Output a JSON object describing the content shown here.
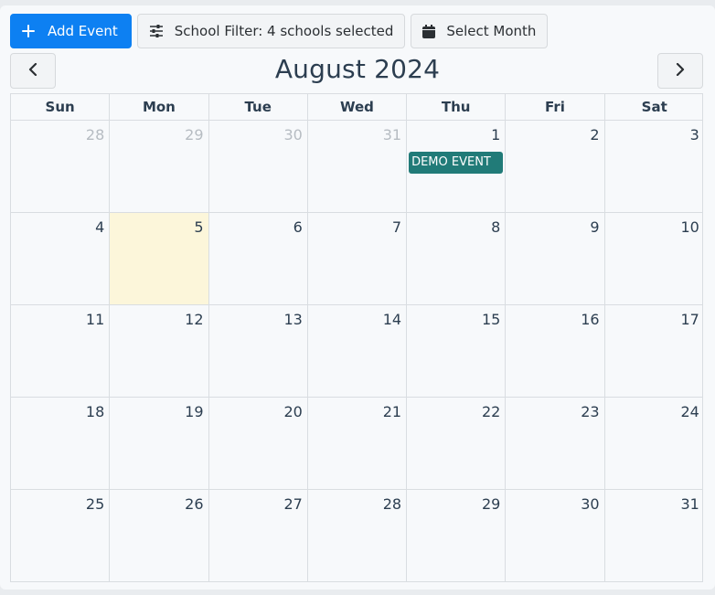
{
  "toolbar": {
    "add_event_label": "Add Event",
    "school_filter_label": "School Filter: 4 schools selected",
    "select_month_label": "Select Month"
  },
  "calendar": {
    "title": "August 2024",
    "weekdays": [
      "Sun",
      "Mon",
      "Tue",
      "Wed",
      "Thu",
      "Fri",
      "Sat"
    ],
    "weeks": [
      [
        "28",
        "29",
        "30",
        "31",
        "1",
        "2",
        "3"
      ],
      [
        "4",
        "5",
        "6",
        "7",
        "8",
        "9",
        "10"
      ],
      [
        "11",
        "12",
        "13",
        "14",
        "15",
        "16",
        "17"
      ],
      [
        "18",
        "19",
        "20",
        "21",
        "22",
        "23",
        "24"
      ],
      [
        "25",
        "26",
        "27",
        "28",
        "29",
        "30",
        "31"
      ]
    ],
    "today_label": "5",
    "events": [
      {
        "label": "DEMO EVENT",
        "date": "1",
        "color": "#217b78"
      }
    ]
  },
  "colors": {
    "primary": "#0d80f2",
    "today_highlight": "#fcf6da",
    "event": "#217b78"
  },
  "icons": {
    "add": "plus-icon",
    "filter": "sliders-icon",
    "month": "calendar-icon",
    "prev": "chevron-left-icon",
    "next": "chevron-right-icon"
  }
}
